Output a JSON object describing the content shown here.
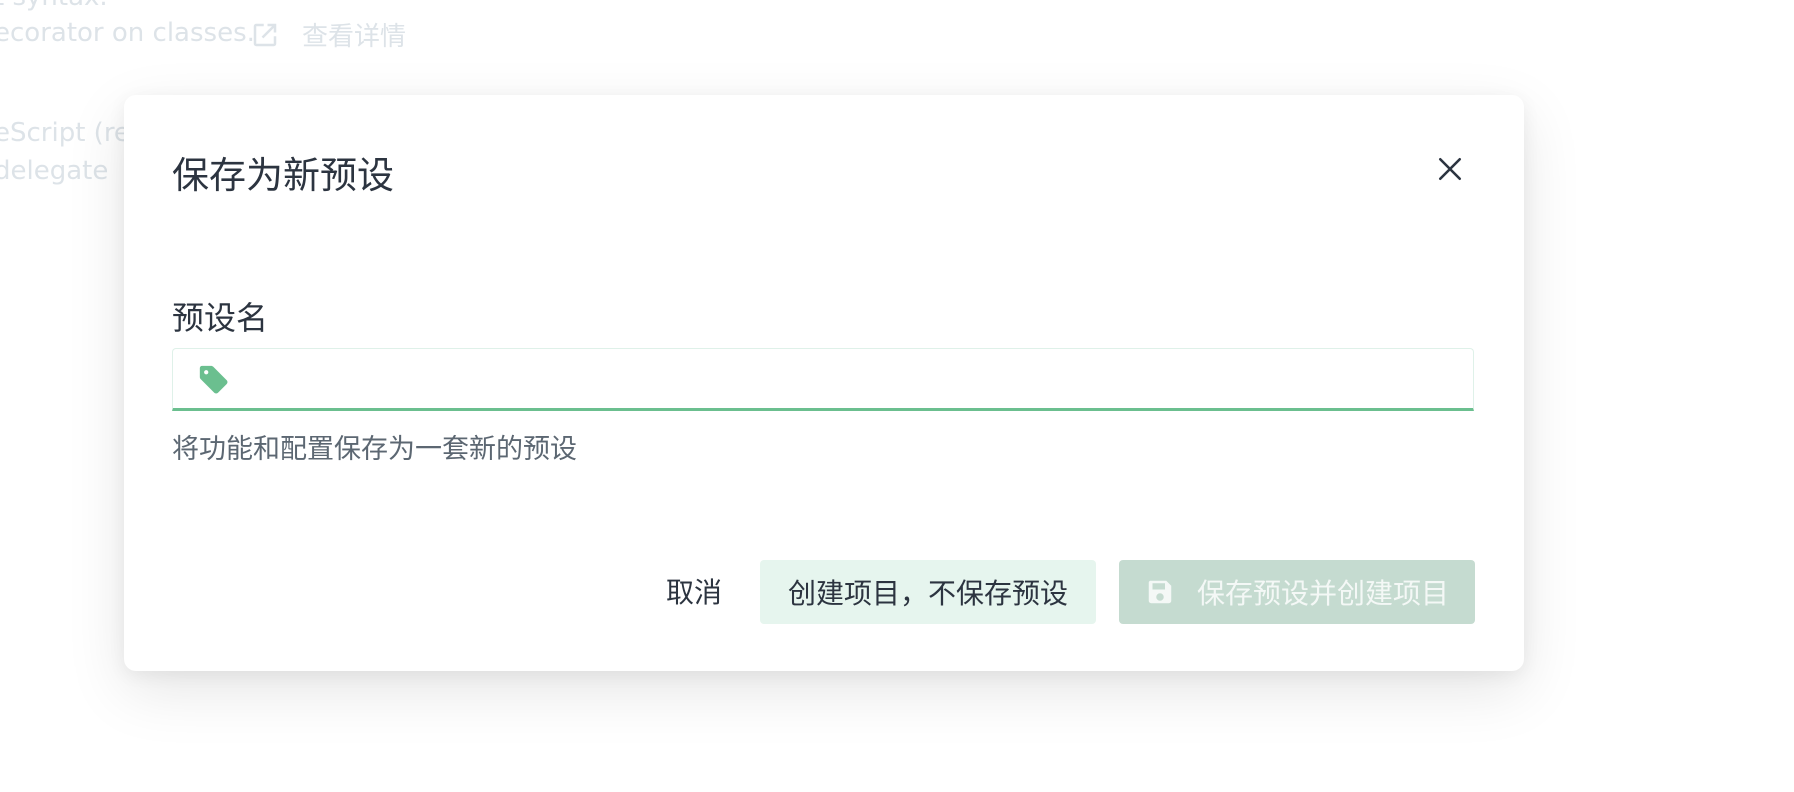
{
  "background": {
    "line1": "t syntax.",
    "line2": "ecorator on classes.",
    "link_label": "查看详情",
    "line3": "eScript (re",
    "line4": " delegate"
  },
  "dialog": {
    "title": "保存为新预设",
    "field_label": "预设名",
    "input_value": "",
    "hint": "将功能和配置保存为一套新的预设",
    "buttons": {
      "cancel": "取消",
      "create_without_save": "创建项目，不保存预设",
      "save_and_create": "保存预设并创建项目"
    }
  },
  "icons": {
    "close": "close-icon",
    "tag": "tag-icon",
    "save": "save-icon",
    "external_link": "external-link-icon"
  },
  "colors": {
    "accent": "#6bbf8f",
    "primary_disabled_bg": "#c5dbd0",
    "secondary_bg": "#e6f5ee",
    "text": "#2c3440",
    "hint_text": "#5c6772"
  }
}
